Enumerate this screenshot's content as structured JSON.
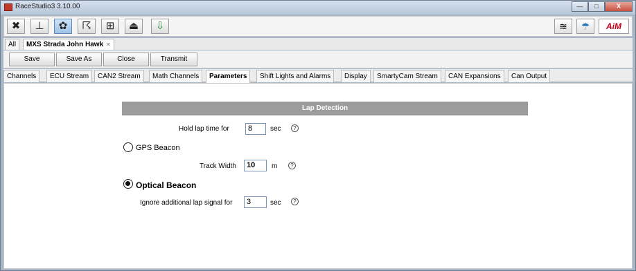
{
  "window": {
    "title": "RaceStudio3 3.10.00",
    "buttons": {
      "minimize": "—",
      "maximize": "□",
      "close": "X"
    }
  },
  "toolbar": {
    "icons": [
      "wrench-icon",
      "device-icon",
      "gear-icon",
      "track-icon",
      "layout-icon",
      "upload-icon",
      "download-icon"
    ],
    "glyphs": [
      "✖",
      "⊥",
      "✿",
      "☈",
      "⊞",
      "⏏",
      "⇩"
    ],
    "wifi_glyph": "≋",
    "cloud_glyph": "☂",
    "logo": "AiM"
  },
  "doc_tabs": {
    "all": "All",
    "current": "MXS Strada John Hawk",
    "close_glyph": "✕"
  },
  "actions": {
    "save": "Save",
    "save_as": "Save As",
    "close": "Close",
    "transmit": "Transmit"
  },
  "subtabs": [
    "Channels",
    "ECU Stream",
    "CAN2 Stream",
    "Math Channels",
    "Parameters",
    "Shift Lights and Alarms",
    "Display",
    "SmartyCam Stream",
    "CAN Expansions",
    "Can Output"
  ],
  "active_subtab": "Parameters",
  "lap_detection": {
    "title": "Lap Detection",
    "hold_label": "Hold lap time for",
    "hold_value": "8",
    "hold_unit": "sec",
    "gps_label": "GPS Beacon",
    "gps_selected": false,
    "track_width_label": "Track Width",
    "track_width_value": "10",
    "track_width_unit": "m",
    "optical_label": "Optical Beacon",
    "optical_selected": true,
    "ignore_label": "Ignore additional lap signal for",
    "ignore_value": "3",
    "ignore_unit": "sec",
    "help_glyph": "?"
  }
}
